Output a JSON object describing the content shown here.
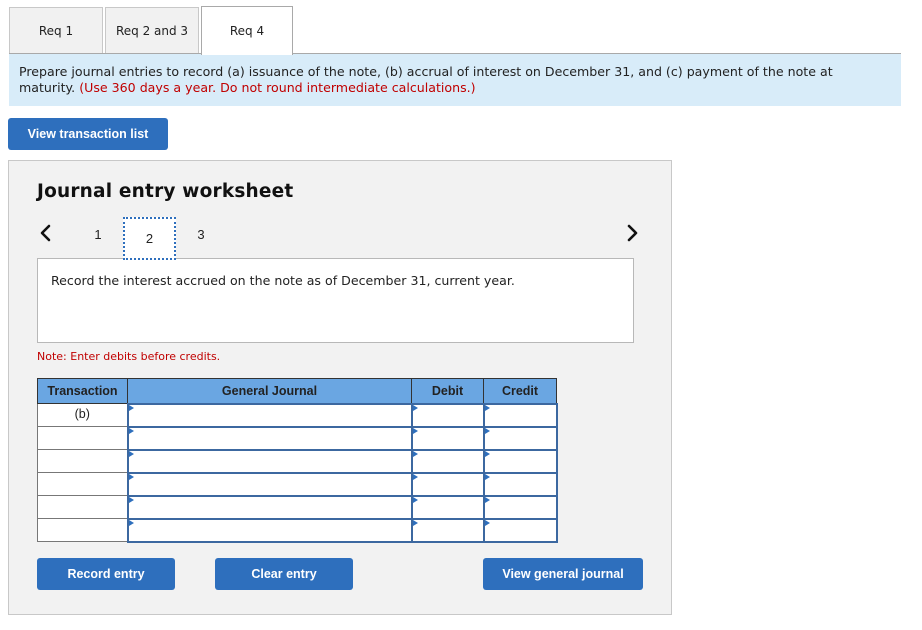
{
  "tabs": [
    {
      "label": "Req 1",
      "active": false
    },
    {
      "label": "Req 2 and 3",
      "active": false
    },
    {
      "label": "Req 4",
      "active": true
    }
  ],
  "instructions": {
    "text": "Prepare journal entries to record (a) issuance of the note, (b) accrual of interest on December 31, and (c) payment of the note at maturity.",
    "highlight": "(Use 360 days a year. Do not round intermediate calculations.)"
  },
  "view_transaction_list_label": "View transaction list",
  "worksheet": {
    "title": "Journal entry worksheet",
    "pager": {
      "prev_icon": "chevron-left-icon",
      "next_icon": "chevron-right-icon",
      "pages": [
        "1",
        "2",
        "3"
      ],
      "current": "2"
    },
    "description": "Record the interest accrued on the note as of December 31, current year.",
    "note": "Note: Enter debits before credits.",
    "table": {
      "headers": {
        "transaction": "Transaction",
        "general_journal": "General Journal",
        "debit": "Debit",
        "credit": "Credit"
      },
      "rows": [
        {
          "transaction": "(b)",
          "account": "",
          "debit": "",
          "credit": ""
        },
        {
          "transaction": "",
          "account": "",
          "debit": "",
          "credit": ""
        },
        {
          "transaction": "",
          "account": "",
          "debit": "",
          "credit": ""
        },
        {
          "transaction": "",
          "account": "",
          "debit": "",
          "credit": ""
        },
        {
          "transaction": "",
          "account": "",
          "debit": "",
          "credit": ""
        },
        {
          "transaction": "",
          "account": "",
          "debit": "",
          "credit": ""
        }
      ]
    },
    "buttons": {
      "record": "Record entry",
      "clear": "Clear entry",
      "view_general_journal": "View general journal"
    }
  },
  "colors": {
    "accent": "#2e6fbd",
    "banner_bg": "#d8ecf9",
    "header_bg": "#6aa6e2",
    "warning_red": "#c00000"
  }
}
